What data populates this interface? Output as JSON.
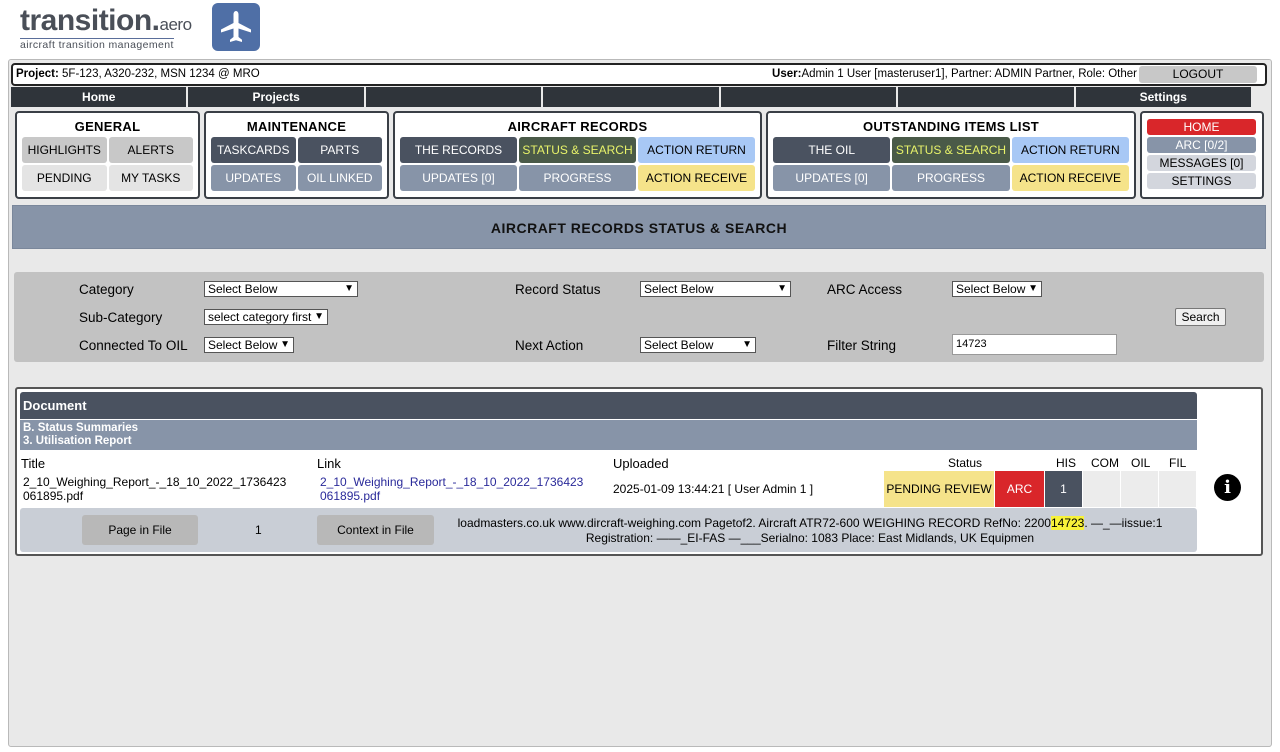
{
  "logo": {
    "brand": "transition.",
    "tld": "aero",
    "tagline": "aircraft transition management"
  },
  "project_bar": {
    "project_label": "Project:",
    "project_value": "5F-123, A320-232, MSN 1234 @ MRO",
    "user_label": "User:",
    "user_value": "Admin 1 User [masteruser1], Partner: ADMIN Partner, Role: Other",
    "logout": "LOGOUT"
  },
  "topnav": [
    "Home",
    "Projects",
    "",
    "",
    "",
    "",
    "Settings"
  ],
  "panels": {
    "general": {
      "title": "GENERAL",
      "buttons": [
        "HIGHLIGHTS",
        "ALERTS",
        "PENDING",
        "MY TASKS"
      ]
    },
    "maintenance": {
      "title": "MAINTENANCE",
      "buttons": [
        "TASKCARDS",
        "PARTS",
        "UPDATES",
        "OIL LINKED"
      ]
    },
    "aircraft_records": {
      "title": "AIRCRAFT RECORDS",
      "buttons": [
        "THE RECORDS",
        "STATUS & SEARCH",
        "ACTION RETURN",
        "UPDATES [0]",
        "PROGRESS",
        "ACTION RECEIVE"
      ]
    },
    "oil": {
      "title": "OUTSTANDING ITEMS LIST",
      "buttons": [
        "THE OIL",
        "STATUS & SEARCH",
        "ACTION RETURN",
        "UPDATES [0]",
        "PROGRESS",
        "ACTION RECEIVE"
      ]
    },
    "right": {
      "buttons": [
        "HOME",
        "ARC [0/2]",
        "MESSAGES [0]",
        "SETTINGS"
      ]
    }
  },
  "page_title": "AIRCRAFT RECORDS STATUS & SEARCH",
  "search": {
    "category_label": "Category",
    "category_value": "Select Below",
    "subcategory_label": "Sub-Category",
    "subcategory_value": "select category first",
    "connected_label": "Connected To OIL",
    "connected_value": "Select Below",
    "record_status_label": "Record Status",
    "record_status_value": "Select Below",
    "next_action_label": "Next Action",
    "next_action_value": "Select Below",
    "arc_access_label": "ARC Access",
    "arc_access_value": "Select Below",
    "filter_label": "Filter String",
    "filter_value": "14723",
    "search_button": "Search"
  },
  "results": {
    "doc_header": "Document",
    "sub_header_1": "B. Status Summaries",
    "sub_header_2": "3. Utilisation Report",
    "columns": {
      "title": "Title",
      "link": "Link",
      "uploaded": "Uploaded",
      "status": "Status",
      "his": "HIS",
      "com": "COM",
      "oil": "OIL",
      "fil": "FIL"
    },
    "row": {
      "title_line1": "2_10_Weighing_Report_-_18_10_2022_1736423",
      "title_line2": "061895.pdf",
      "link_line1": "2_10_Weighing_Report_-_18_10_2022_1736423",
      "link_line2": "061895.pdf",
      "uploaded": "2025-01-09 13:44:21 [ User Admin 1 ]",
      "status": "PENDING REVIEW",
      "arc": "ARC",
      "his": "1",
      "info": "i"
    },
    "context": {
      "page_button": "Page in File",
      "page_number": "1",
      "context_button": "Context in File",
      "text_before": "loadmasters.co.uk www.dircraft-weighing.com Pagetof2. Aircraft ATR72-600 WEIGHING RECORD RefNo: 2200",
      "highlight": "14723",
      "text_after": ". —_—iissue:1",
      "line2": "Registration: ——_EI-FAS —___Serialno: 1083 Place: East Midlands, UK Equipmen"
    }
  }
}
